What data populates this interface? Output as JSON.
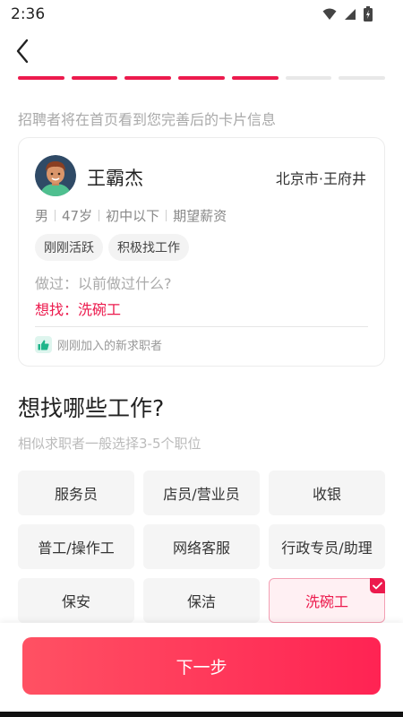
{
  "status_bar": {
    "time": "2:36"
  },
  "progress": {
    "total_steps": 7,
    "completed_steps": 5
  },
  "hint": "招聘者将在首页看到您完善后的卡片信息",
  "card": {
    "name": "王霸杰",
    "location": "北京市·王府井",
    "meta": [
      "男",
      "47岁",
      "初中以下",
      "期望薪资"
    ],
    "tags": [
      "刚刚活跃",
      "积极找工作"
    ],
    "did": "做过：以前做过什么?",
    "want": "想找：洗碗工",
    "joined": "刚刚加入的新求职者"
  },
  "section": {
    "title": "想找哪些工作?",
    "subtitle": "相似求职者一般选择3-5个职位"
  },
  "jobs": [
    {
      "label": "服务员",
      "selected": false
    },
    {
      "label": "店员/营业员",
      "selected": false
    },
    {
      "label": "收银",
      "selected": false
    },
    {
      "label": "普工/操作工",
      "selected": false
    },
    {
      "label": "网络客服",
      "selected": false
    },
    {
      "label": "行政专员/助理",
      "selected": false
    },
    {
      "label": "保安",
      "selected": false
    },
    {
      "label": "保洁",
      "selected": false
    },
    {
      "label": "洗碗工",
      "selected": true
    }
  ],
  "next_button": "下一步",
  "colors": {
    "accent": "#ec1a4d",
    "button_start": "#ff5163",
    "button_end": "#ff2353"
  }
}
